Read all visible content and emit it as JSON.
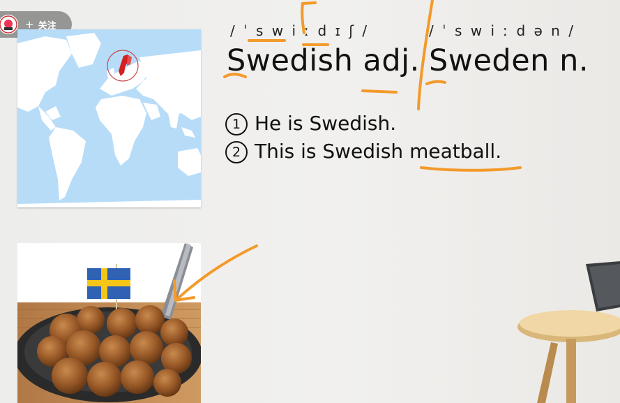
{
  "follow_widget": {
    "plus": "+",
    "label": "关注"
  },
  "ipa_swedish": "/ ˈ s w i ː d ɪ ʃ /",
  "ipa_sweden": "/ ˈ s w i ː d ə n /",
  "word_swedish": "Swedish adj.",
  "word_sweden": "Sweden n.",
  "sentences": [
    {
      "num": "1",
      "text": "He is Swedish."
    },
    {
      "num": "2",
      "text": "This is Swedish meatball."
    }
  ],
  "colors": {
    "highlight": "#f39a2b",
    "sweden": "#d32020",
    "ocean": "#b7dcf8",
    "flag_blue": "#2f62b3",
    "flag_yellow": "#f5c518"
  }
}
